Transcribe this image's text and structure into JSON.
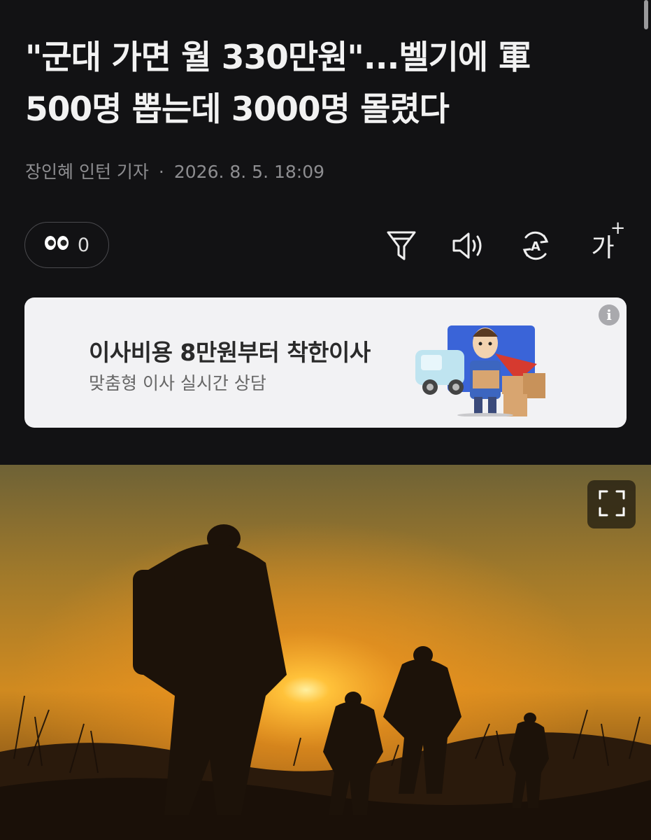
{
  "article": {
    "title_line1": "\"군대 가면 월 330만원\"...벨기에 軍",
    "title_line2": "500명 뽑는데 3000명 몰렸다",
    "author": "장인혜 인턴 기자",
    "separator": "·",
    "datetime": "2026. 8. 5. 18:09"
  },
  "toolbar": {
    "reaction_icon": "eyes-icon",
    "reaction_count": "0",
    "tools": [
      "filter-icon",
      "speaker-icon",
      "translate-icon",
      "font-size-icon"
    ],
    "font_size_label": "가",
    "font_size_plus": "+"
  },
  "ad": {
    "title": "이사비용 8만원부터 착한이사",
    "subtitle": "맞춤형 이사 실시간 상담",
    "info_label": "i"
  },
  "photo": {
    "description_icon": "expand-icon"
  },
  "colors": {
    "background": "#121214",
    "ad_background": "#f2f2f4",
    "sunset_top": "#7a6a3a",
    "sunset_glow": "#f39a18"
  }
}
